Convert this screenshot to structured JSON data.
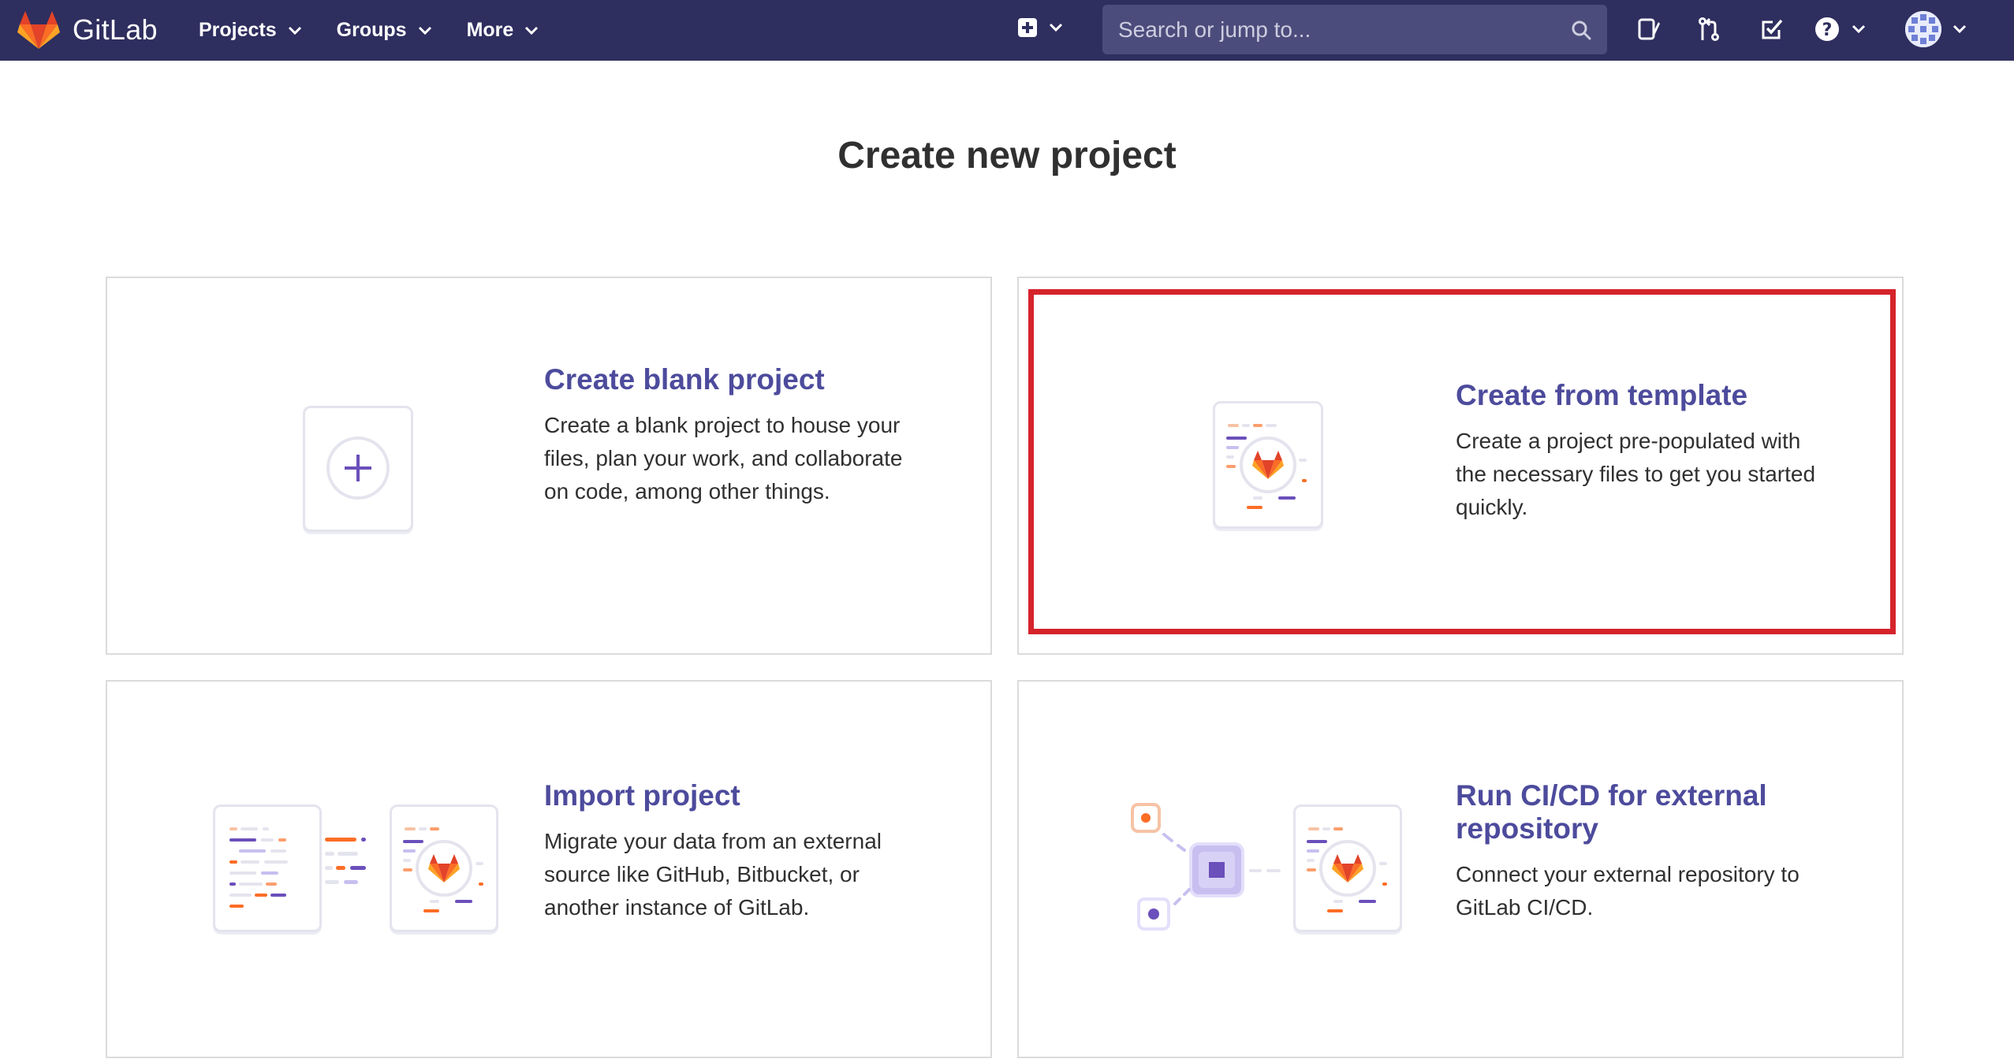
{
  "navbar": {
    "brand_name": "GitLab",
    "menu": [
      {
        "label": "Projects"
      },
      {
        "label": "Groups"
      },
      {
        "label": "More"
      }
    ],
    "search_placeholder": "Search or jump to...",
    "icons": [
      "plus-square-icon",
      "search-icon",
      "issues-icon",
      "merge-request-icon",
      "todo-icon",
      "help-icon",
      "user-avatar"
    ]
  },
  "page": {
    "title": "Create new project"
  },
  "cards": [
    {
      "title": "Create blank project",
      "description": "Create a blank project to house your files, plan your work, and collaborate on code, among other things."
    },
    {
      "title": "Create from template",
      "description": "Create a project pre-populated with the necessary files to get you started quickly."
    },
    {
      "title": "Import project",
      "description": "Migrate your data from an external source like GitHub, Bitbucket, or another instance of GitLab."
    },
    {
      "title": "Run CI/CD for external repository",
      "description": "Connect your external repository to GitLab CI/CD."
    }
  ],
  "colors": {
    "navbar_bg": "#2e2e5f",
    "card_title": "#4d4b9c",
    "highlight": "#d5232b",
    "fox_orange": "#e24329",
    "accent_purple": "#6b4fbb"
  }
}
